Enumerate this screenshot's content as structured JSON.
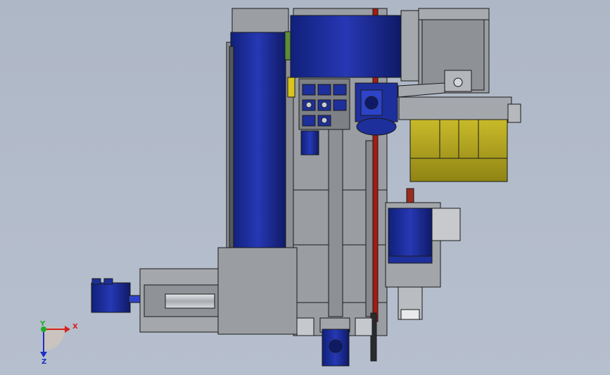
{
  "viewport": {
    "background_top": "#aeb7c5",
    "background_bottom": "#b6bfcd"
  },
  "model": {
    "colors": {
      "frame_gray": "#8f9296",
      "frame_light": "#a9acb0",
      "frame_dark": "#5e6166",
      "motor_blue": "#1d2f9a",
      "motor_blue_dark": "#0f1a66",
      "hopper_olive": "#b5a71e",
      "rail_red": "#a51c14",
      "edge_black": "#1a1a1a"
    },
    "icons": [
      "servo-motor-icon",
      "gear-motor-icon",
      "hopper-icon",
      "clamp-icon"
    ]
  },
  "triad": {
    "x_label": "X",
    "y_label": "Y",
    "z_label": "Z",
    "x_color": "#d6201e",
    "y_color": "#1fae2a",
    "z_color": "#1b2fc4"
  }
}
